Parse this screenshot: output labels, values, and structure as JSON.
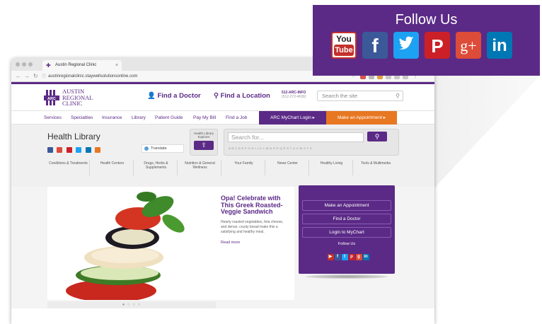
{
  "browser": {
    "tab_title": "Austin Regional Clinic",
    "tab_close": "×",
    "url": "austinregionalclinic.staywellsolutionsonline.com"
  },
  "header": {
    "logo_line1": "AUSTIN",
    "logo_line2": "REGIONAL",
    "logo_line3": "CLINIC",
    "find_doctor": "Find a Doctor",
    "find_location": "Find a Location",
    "phone_line1": "512-ARC-INFO",
    "phone_line2": "(512-272-4636)",
    "search_placeholder": "Search the site"
  },
  "nav": {
    "items": [
      "Services",
      "Specialties",
      "Insurance",
      "Library",
      "Patient Guide",
      "Pay My Bill",
      "Find a Job"
    ],
    "mychart": "ARC MyChart Login ▸",
    "appointment": "Make an Appointment ▸"
  },
  "library": {
    "title": "Health Library",
    "translate": "Translate",
    "explorer_label": "Health Library Explorer",
    "search_placeholder": "Search for...",
    "alphabet": "A B C D E F G H I J K L M N O P Q R S T U V W X Y Z",
    "categories": [
      "Conditions & Treatments",
      "Health Centers",
      "Drugs, Herbs & Supplements",
      "Nutrition & General Wellness",
      "Your Family",
      "News Center",
      "Healthy Living",
      "Tools & Multimedia"
    ]
  },
  "article": {
    "title": "Opa! Celebrate with This Greek Roasted-Veggie Sandwich",
    "body": "Hearty roasted vegetables, feta cheese, and dense, crusty bread make this a satisfying and healthy meal.",
    "more": "Read more"
  },
  "side_panel": {
    "buttons": [
      "Make an Appointment",
      "Find a Doctor",
      "Login to MyChart"
    ],
    "follow": "Follow Us"
  },
  "callout": {
    "title": "Follow Us",
    "youtube_line1": "You",
    "youtube_line2": "Tube",
    "facebook": "f",
    "pinterest": "P",
    "googleplus": "g+",
    "linkedin": "in"
  },
  "colors": {
    "brand_purple": "#5b2a86",
    "orange": "#e87722",
    "youtube": "#c4302b",
    "facebook": "#3b5998",
    "twitter": "#1da1f2",
    "pinterest": "#cb2027",
    "googleplus": "#dd4b39",
    "linkedin": "#0077b5"
  },
  "icons": [
    "youtube-icon",
    "facebook-icon",
    "twitter-icon",
    "pinterest-icon",
    "google-plus-icon",
    "linkedin-icon"
  ]
}
